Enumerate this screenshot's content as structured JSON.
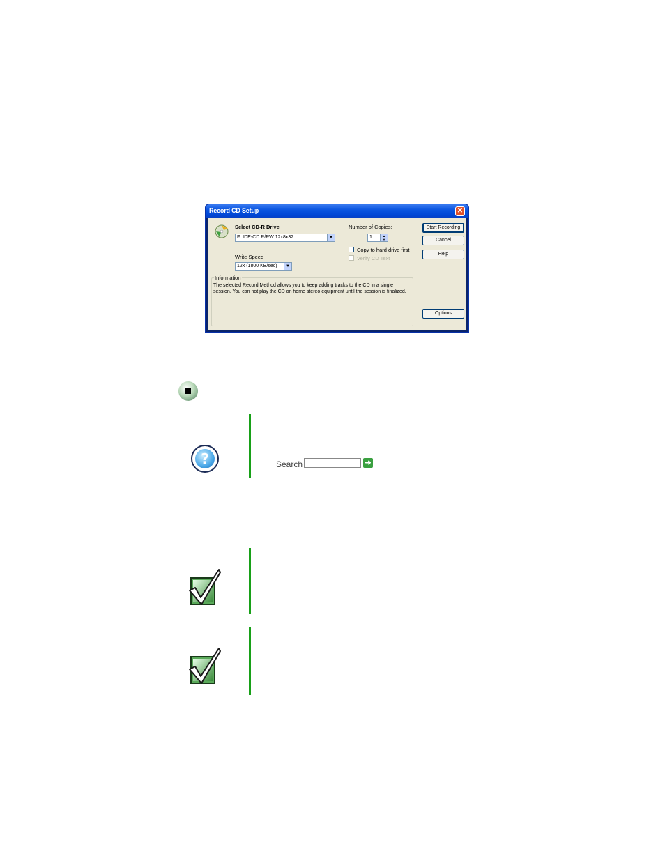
{
  "dialog": {
    "title": "Record CD Setup",
    "close_glyph": "✕",
    "select_drive_label": "Select CD-R Drive",
    "drive_value": "F: IDE-CD R/RW 12x8x32",
    "write_speed_label": "Write Speed",
    "write_speed_value": "12x (1800 KB/sec)",
    "copies_label": "Number of Copies:",
    "copies_value": "1",
    "copy_to_hd_label": "Copy to hard drive first",
    "verify_label": "Verify CD Text",
    "info_group_label": "Information",
    "info_text": "The selected Record Method allows you to keep adding tracks to the CD in a single session. You can not play the CD on home stereo equipment until the session is finalized.",
    "buttons": {
      "start": "Start Recording",
      "cancel": "Cancel",
      "help": "Help",
      "options": "Options"
    },
    "dropdown_glyph": "▼",
    "spin_up": "▲",
    "spin_down": "▼"
  },
  "help_box": {
    "icon": "help-question-icon",
    "search_label": "Search",
    "search_go_glyph": "➜"
  },
  "icons": {
    "stop_bullet": "stop-bullet-icon",
    "important": "checkmark-icon"
  },
  "colors": {
    "accent_green": "#18a018",
    "titlebar_blue": "#0a55e0"
  }
}
